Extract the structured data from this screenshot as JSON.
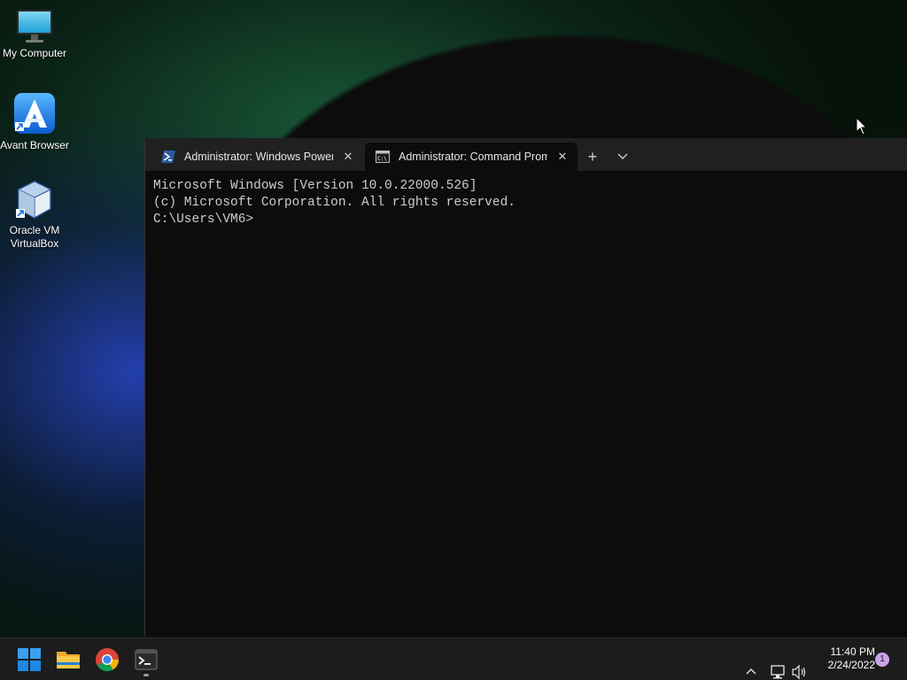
{
  "desktop": {
    "icons": [
      {
        "label": "My Computer",
        "icon": "monitor-icon"
      },
      {
        "label": "Avant Browser",
        "icon": "avant-browser-icon"
      },
      {
        "label": "Oracle VM VirtualBox",
        "icon": "virtualbox-icon"
      }
    ]
  },
  "terminal": {
    "tabs": [
      {
        "title": "Administrator: Windows PowerShell",
        "icon": "powershell-icon",
        "active": false
      },
      {
        "title": "Administrator: Command Prompt",
        "icon": "cmd-icon",
        "active": true
      }
    ],
    "new_tab_label": "+",
    "dropdown_label": "⌄",
    "console_lines": [
      "Microsoft Windows [Version 10.0.22000.526]",
      "(c) Microsoft Corporation. All rights reserved.",
      "",
      "C:\\Users\\VM6>"
    ]
  },
  "taskbar": {
    "apps": [
      {
        "name": "Start",
        "icon": "windows-start-icon"
      },
      {
        "name": "File Explorer",
        "icon": "folder-icon"
      },
      {
        "name": "Google Chrome",
        "icon": "chrome-icon"
      },
      {
        "name": "Terminal",
        "icon": "terminal-icon",
        "running": true
      }
    ],
    "clock": {
      "time": "11:40 PM",
      "date": "2/24/2022"
    },
    "notification_count": "1"
  },
  "colors": {
    "terminal_bg": "#0c0c0c",
    "tabbar_bg": "#202020",
    "taskbar_bg": "#1c1c1c",
    "console_text": "#cccccc",
    "badge": "#c9a3e8"
  }
}
